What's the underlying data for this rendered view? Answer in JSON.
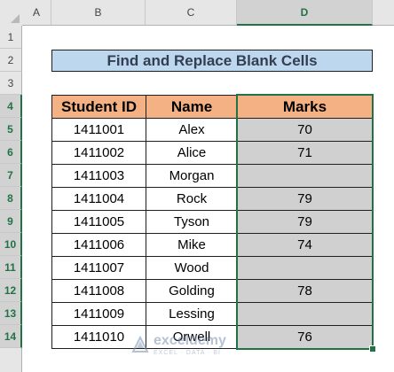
{
  "spreadsheet": {
    "columns": [
      "A",
      "B",
      "C",
      "D"
    ],
    "rows": [
      "1",
      "2",
      "3",
      "4",
      "5",
      "6",
      "7",
      "8",
      "9",
      "10",
      "11",
      "12",
      "13",
      "14"
    ],
    "selected_column": "D",
    "selected_rows": [
      "4",
      "5",
      "6",
      "7",
      "8",
      "9",
      "10",
      "11",
      "12",
      "13",
      "14"
    ]
  },
  "title": "Find and Replace Blank Cells",
  "table": {
    "headers": [
      "Student ID",
      "Name",
      "Marks"
    ],
    "rows": [
      [
        "1411001",
        "Alex",
        "70"
      ],
      [
        "1411002",
        "Alice",
        "71"
      ],
      [
        "1411003",
        "Morgan",
        ""
      ],
      [
        "1411004",
        "Rock",
        "79"
      ],
      [
        "1411005",
        "Tyson",
        "79"
      ],
      [
        "1411006",
        "Mike",
        "74"
      ],
      [
        "1411007",
        "Wood",
        ""
      ],
      [
        "1411008",
        "Golding",
        "78"
      ],
      [
        "1411009",
        "Lessing",
        ""
      ],
      [
        "1411010",
        "Orwell",
        "76"
      ]
    ]
  },
  "watermark": {
    "name": "exceldemy",
    "tagline": "EXCEL · DATA · BI"
  },
  "colors": {
    "title_fill": "#bdd7ee",
    "header_fill": "#f4b183",
    "selection_fill": "#d0d0d0",
    "selection_border": "#217346"
  }
}
